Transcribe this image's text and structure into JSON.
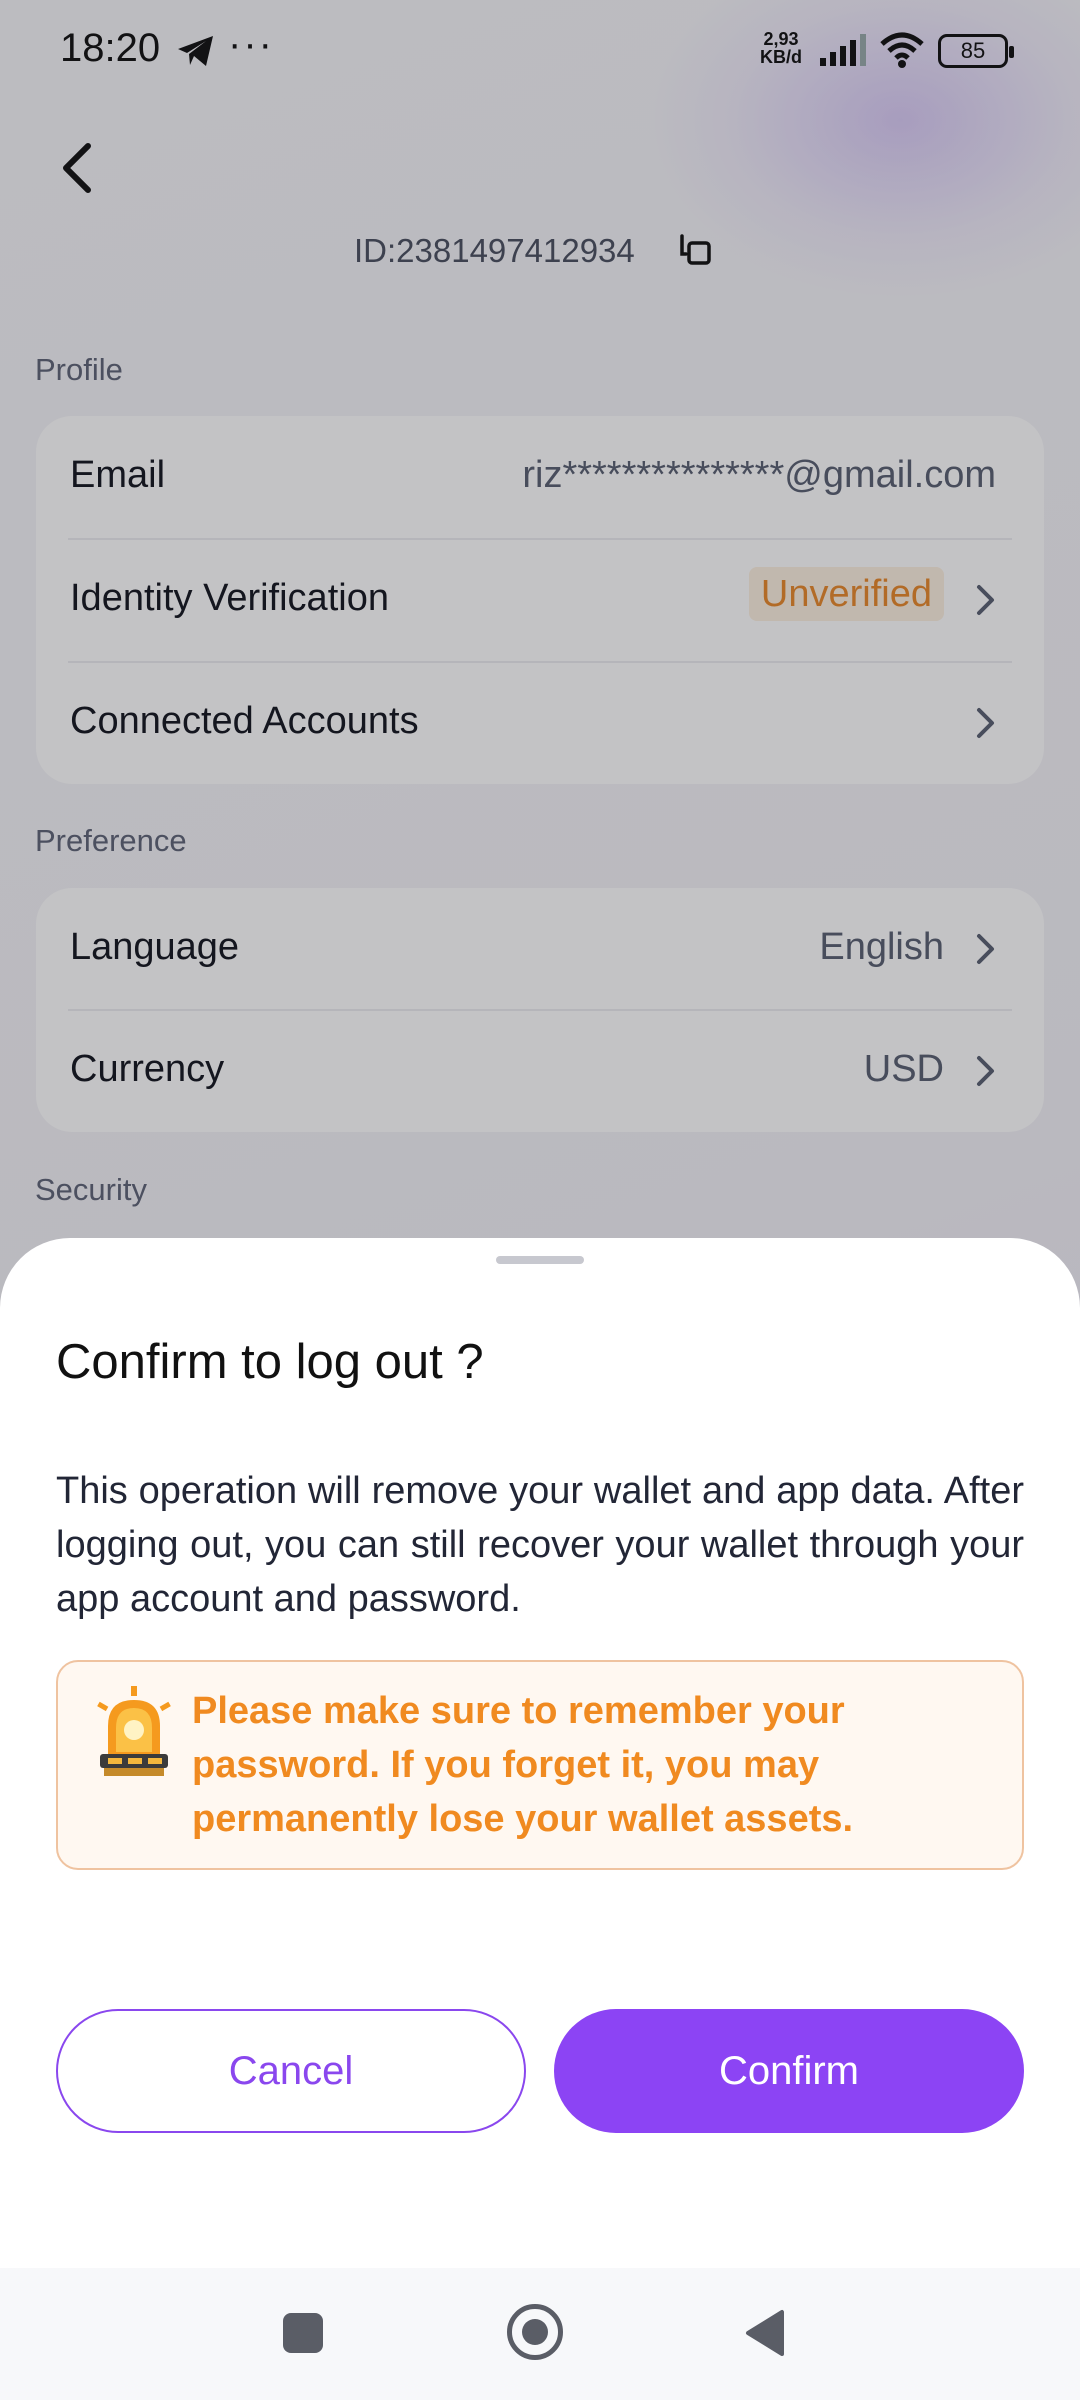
{
  "status_bar": {
    "time": "18:20",
    "net_speed_value": "2,93",
    "net_speed_unit": "KB/d",
    "battery": "85",
    "icons": [
      "telegram-icon",
      "more-dots-icon",
      "signal-icon",
      "wifi-icon",
      "battery-icon"
    ]
  },
  "header": {
    "account_id": "ID:2381497412934",
    "icons": [
      "back-arrow-icon",
      "copy-icon"
    ]
  },
  "sections": {
    "profile_label": "Profile",
    "preference_label": "Preference",
    "security_label": "Security"
  },
  "profile": {
    "email_label": "Email",
    "email_value": "riz***************@gmail.com",
    "identity_label": "Identity Verification",
    "identity_status": "Unverified",
    "connected_label": "Connected Accounts"
  },
  "preference": {
    "language_label": "Language",
    "language_value": "English",
    "currency_label": "Currency",
    "currency_value": "USD"
  },
  "dialog": {
    "title": "Confirm to log out ?",
    "body": "This operation will remove your wallet and app data. After logging out, you can still recover your wallet through your app account and password.",
    "warning": "Please make sure to remember your password. If you forget it, you may permanently lose your wallet assets.",
    "cancel_label": "Cancel",
    "confirm_label": "Confirm"
  },
  "colors": {
    "accent": "#8c44f4",
    "warning_text": "#f08a20",
    "warning_bg": "#fff8f1",
    "unverified_text": "#e9892b"
  },
  "navbar": {
    "icons": [
      "recents-square-icon",
      "home-circle-icon",
      "back-triangle-icon"
    ]
  }
}
